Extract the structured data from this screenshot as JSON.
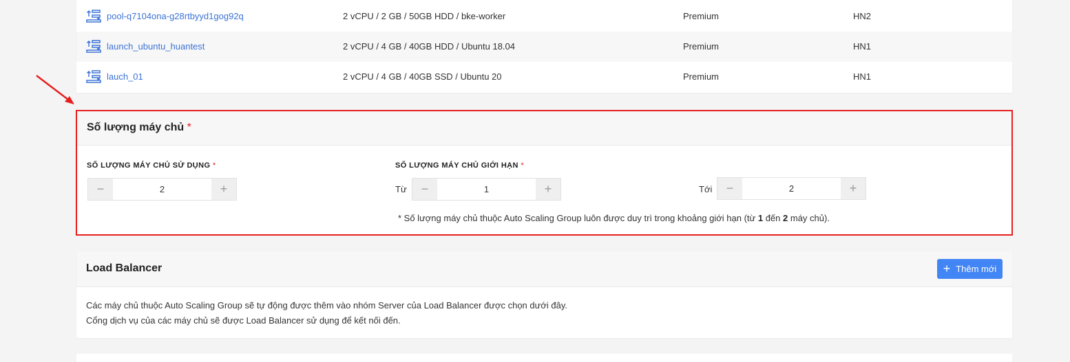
{
  "pools": [
    {
      "name": "pool-q7104ona-g28rtbyyd1gog92q",
      "spec": "2 vCPU / 2 GB / 50GB HDD / bke-worker",
      "type": "Premium",
      "zone": "HN2"
    },
    {
      "name": "launch_ubuntu_huantest",
      "spec": "2 vCPU / 4 GB / 40GB HDD / Ubuntu 18.04",
      "type": "Premium",
      "zone": "HN1"
    },
    {
      "name": "lauch_01",
      "spec": "2 vCPU / 4 GB / 40GB SSD / Ubuntu 20",
      "type": "Premium",
      "zone": "HN1"
    }
  ],
  "server_count": {
    "title": "Số lượng máy chủ",
    "required_mark": "*",
    "used_label": "SỐ LƯỢNG MÁY CHỦ SỬ DỤNG",
    "used_value": "2",
    "limit_label": "SỐ LƯỢNG MÁY CHỦ GIỚI HẠN",
    "from_label": "Từ",
    "from_value": "1",
    "to_label": "Tới",
    "to_value": "2",
    "minus": "−",
    "plus": "+",
    "note_prefix": "* Số lượng máy chủ thuộc Auto Scaling Group luôn được duy trì trong khoảng giới hạn (từ ",
    "note_min": "1",
    "note_mid": " đến ",
    "note_max": "2",
    "note_suffix": " máy chủ)."
  },
  "load_balancer": {
    "title": "Load Balancer",
    "add_label": "Thêm mới",
    "desc_1": "Các máy chủ thuộc Auto Scaling Group sẽ tự động được thêm vào nhóm Server của Load Balancer được chọn dưới đây.",
    "desc_2": "Cổng dịch vụ của các máy chủ sẽ được Load Balancer sử dụng để kết nối đến."
  },
  "colors": {
    "accent": "#4285f4",
    "link": "#3c73d6",
    "highlight": "#e61e1e"
  },
  "icons": {
    "pool": "pool-scale-icon",
    "arrow": "annotation-arrow-icon",
    "add": "plus-icon"
  }
}
